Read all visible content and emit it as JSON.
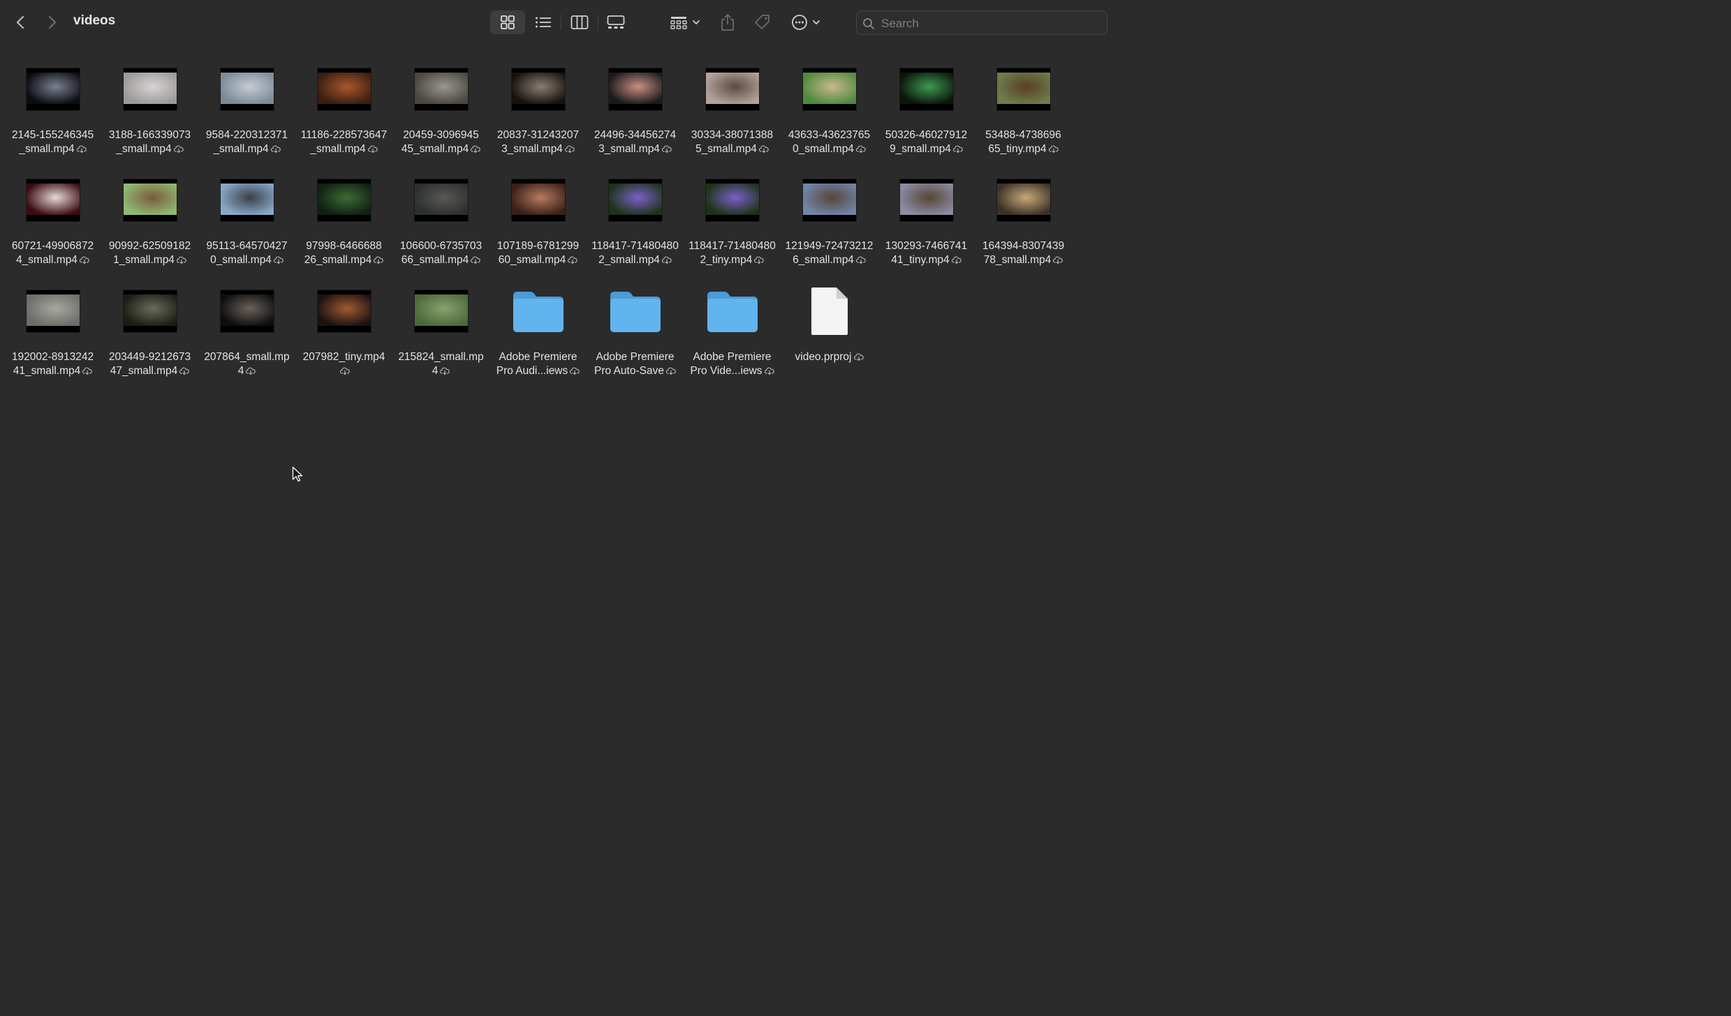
{
  "window": {
    "title": "videos"
  },
  "toolbar": {
    "back_icon": "chevron-left-icon",
    "forward_icon": "chevron-right-icon",
    "views": [
      "icon-view",
      "list-view",
      "column-view",
      "gallery-view"
    ],
    "active_view": "icon-view",
    "group_icon": "group-grid-icon",
    "share_icon": "share-icon",
    "tag_icon": "tag-icon",
    "more_icon": "ellipsis-circle-icon"
  },
  "search": {
    "placeholder": "Search",
    "value": ""
  },
  "items": [
    {
      "name": "2145-155246345_small.mp4",
      "line1": "2145-155246345",
      "line2": "_small.mp4",
      "kind": "video",
      "colors": [
        "#0b0d14",
        "#7c8190"
      ]
    },
    {
      "name": "3188-166339073_small.mp4",
      "line1": "3188-166339073",
      "line2": "_small.mp4",
      "kind": "video",
      "colors": [
        "#9c9a99",
        "#d6d4d3"
      ]
    },
    {
      "name": "9584-220312371_small.mp4",
      "line1": "9584-220312371",
      "line2": "_small.mp4",
      "kind": "video",
      "colors": [
        "#7b8a98",
        "#c7ccd2"
      ]
    },
    {
      "name": "11186-228573647_small.mp4",
      "line1": "11186-228573647",
      "line2": "_small.mp4",
      "kind": "video",
      "colors": [
        "#3a1e12",
        "#a7582a"
      ]
    },
    {
      "name": "20459-309694545_small.mp4",
      "line1": "20459-3096945",
      "line2": "45_small.mp4",
      "kind": "video",
      "colors": [
        "#4a4640",
        "#9a978f"
      ]
    },
    {
      "name": "20837-312432073_small.mp4",
      "line1": "20837-31243207",
      "line2": "3_small.mp4",
      "kind": "video",
      "colors": [
        "#161210",
        "#8a7e72"
      ]
    },
    {
      "name": "24496-344562743_small.mp4",
      "line1": "24496-34456274",
      "line2": "3_small.mp4",
      "kind": "video",
      "colors": [
        "#1a1a1c",
        "#c99080"
      ]
    },
    {
      "name": "30334-380713885_small.mp4",
      "line1": "30334-38071388",
      "line2": "5_small.mp4",
      "kind": "video",
      "colors": [
        "#b2a39a",
        "#5e4a3f"
      ]
    },
    {
      "name": "43633-436237650_small.mp4",
      "line1": "43633-43623765",
      "line2": "0_small.mp4",
      "kind": "video",
      "colors": [
        "#4e8a3e",
        "#c9b98a"
      ]
    },
    {
      "name": "50326-460279129_small.mp4",
      "line1": "50326-46027912",
      "line2": "9_small.mp4",
      "kind": "video",
      "colors": [
        "#0b150b",
        "#3e9a52"
      ]
    },
    {
      "name": "53488-473869665_tiny.mp4",
      "line1": "53488-4738696",
      "line2": "65_tiny.mp4",
      "kind": "video",
      "colors": [
        "#6d7d4a",
        "#5b3e28"
      ]
    },
    {
      "name": "60721-499068724_small.mp4",
      "line1": "60721-49906872",
      "line2": "4_small.mp4",
      "kind": "video",
      "colors": [
        "#3a0c10",
        "#e7d8d8"
      ]
    },
    {
      "name": "90992-625091821_small.mp4",
      "line1": "90992-62509182",
      "line2": "1_small.mp4",
      "kind": "video",
      "colors": [
        "#8fb873",
        "#7a5a3a"
      ]
    },
    {
      "name": "95113-645704270_small.mp4",
      "line1": "95113-64570427",
      "line2": "0_small.mp4",
      "kind": "video",
      "colors": [
        "#88a7c8",
        "#3b4048"
      ]
    },
    {
      "name": "97998-646668826_small.mp4",
      "line1": "97998-6466688",
      "line2": "26_small.mp4",
      "kind": "video",
      "colors": [
        "#0f2012",
        "#3e6a36"
      ]
    },
    {
      "name": "106600-673570366_small.mp4",
      "line1": "106600-6735703",
      "line2": "66_small.mp4",
      "kind": "video",
      "colors": [
        "#2b2f30",
        "#5a5a52"
      ]
    },
    {
      "name": "107189-678129960_small.mp4",
      "line1": "107189-6781299",
      "line2": "60_small.mp4",
      "kind": "video",
      "colors": [
        "#3a2018",
        "#b87a60"
      ]
    },
    {
      "name": "118417-714804802_small.mp4",
      "line1": "118417-71480480",
      "line2": "2_small.mp4",
      "kind": "video",
      "colors": [
        "#1d3318",
        "#7a60c8"
      ]
    },
    {
      "name": "118417-714804802_tiny.mp4",
      "line1": "118417-71480480",
      "line2": "2_tiny.mp4",
      "kind": "video",
      "colors": [
        "#1d3318",
        "#7a60c8"
      ]
    },
    {
      "name": "121949-724732126_small.mp4",
      "line1": "121949-72473212",
      "line2": "6_small.mp4",
      "kind": "video",
      "colors": [
        "#6f86a8",
        "#5a4438"
      ]
    },
    {
      "name": "130293-746674141_tiny.mp4",
      "line1": "130293-7466741",
      "line2": "41_tiny.mp4",
      "kind": "video",
      "colors": [
        "#8a8aa0",
        "#574638"
      ]
    },
    {
      "name": "164394-830743978_small.mp4",
      "line1": "164394-8307439",
      "line2": "78_small.mp4",
      "kind": "video",
      "colors": [
        "#3a3228",
        "#c9a878"
      ]
    },
    {
      "name": "192002-891324241_small.mp4",
      "line1": "192002-8913242",
      "line2": "41_small.mp4",
      "kind": "video",
      "colors": [
        "#6c6c68",
        "#a8a8a2"
      ]
    },
    {
      "name": "203449-921267347_small.mp4",
      "line1": "203449-9212673",
      "line2": "47_small.mp4",
      "kind": "video",
      "colors": [
        "#1a1e16",
        "#6a6c5a"
      ]
    },
    {
      "name": "207864_small.mp4",
      "line1": "207864_small.mp",
      "line2": "4",
      "kind": "video",
      "colors": [
        "#0e0e0e",
        "#6a625a"
      ]
    },
    {
      "name": "207982_tiny.mp4",
      "line1": "207982_tiny.mp4",
      "line2": "",
      "kind": "video",
      "colors": [
        "#1a1212",
        "#a05a30"
      ]
    },
    {
      "name": "215824_small.mp4",
      "line1": "215824_small.mp",
      "line2": "4",
      "kind": "video",
      "colors": [
        "#4a6a3a",
        "#8aa070"
      ]
    },
    {
      "name": "Adobe Premiere Pro Audio Previews",
      "line1": "Adobe Premiere",
      "line2": "Pro Audi...iews",
      "kind": "folder"
    },
    {
      "name": "Adobe Premiere Pro Auto-Save",
      "line1": "Adobe Premiere",
      "line2": "Pro Auto-Save",
      "kind": "folder"
    },
    {
      "name": "Adobe Premiere Pro Video Previews",
      "line1": "Adobe Premiere",
      "line2": "Pro Vide...iews",
      "kind": "folder"
    },
    {
      "name": "video.prproj",
      "line1": "video.prproj",
      "line2": "",
      "kind": "document"
    }
  ],
  "colors": {
    "background": "#2b2b2b",
    "folder": "#5aaee8",
    "text": "#e4e4e4"
  }
}
